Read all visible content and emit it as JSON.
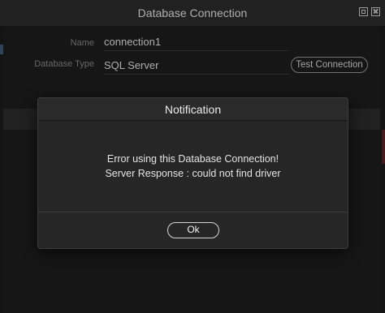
{
  "window": {
    "title": "Database Connection"
  },
  "form": {
    "name_label": "Name",
    "name_value": "connection1",
    "type_label": "Database Type",
    "type_value": "SQL Server",
    "test_button": "Test Connection"
  },
  "dialog": {
    "title": "Notification",
    "message_line1": "Error using this Database Connection!",
    "message_line2": "Server Response : could not find driver",
    "ok_button": "Ok"
  }
}
